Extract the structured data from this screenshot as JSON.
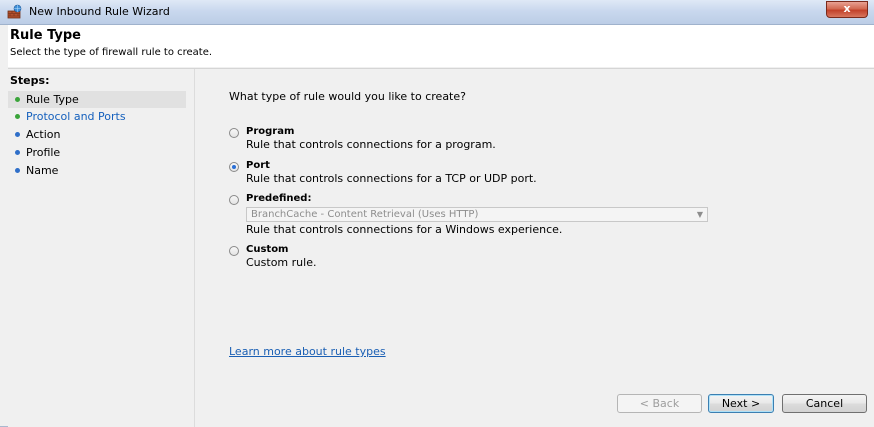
{
  "window": {
    "title": "New Inbound Rule Wizard",
    "close_label": "x"
  },
  "header": {
    "title": "Rule Type",
    "subtitle": "Select the type of firewall rule to create."
  },
  "steps": {
    "label": "Steps:",
    "items": [
      {
        "label": "Rule Type",
        "state": "current"
      },
      {
        "label": "Protocol and Ports",
        "state": "link"
      },
      {
        "label": "Action",
        "state": "normal"
      },
      {
        "label": "Profile",
        "state": "normal"
      },
      {
        "label": "Name",
        "state": "normal"
      }
    ]
  },
  "main": {
    "question": "What type of rule would you like to create?",
    "options": [
      {
        "title": "Program",
        "description": "Rule that controls connections for a program.",
        "selected": false
      },
      {
        "title": "Port",
        "description": "Rule that controls connections for a TCP or UDP port.",
        "selected": true
      },
      {
        "title": "Predefined:",
        "description": "Rule that controls connections for a Windows experience.",
        "selected": false
      },
      {
        "title": "Custom",
        "description": "Custom rule.",
        "selected": false
      }
    ],
    "predefined_dropdown": {
      "selected_value": "BranchCache - Content Retrieval (Uses HTTP)",
      "enabled": false
    },
    "learn_more_link": "Learn more about rule types"
  },
  "buttons": {
    "back": "< Back",
    "next": "Next >",
    "cancel": "Cancel"
  },
  "colors": {
    "step_bullet_green": "#3aa43a",
    "step_bullet_blue": "#2f6fc9",
    "link_blue": "#1a5fb4"
  }
}
